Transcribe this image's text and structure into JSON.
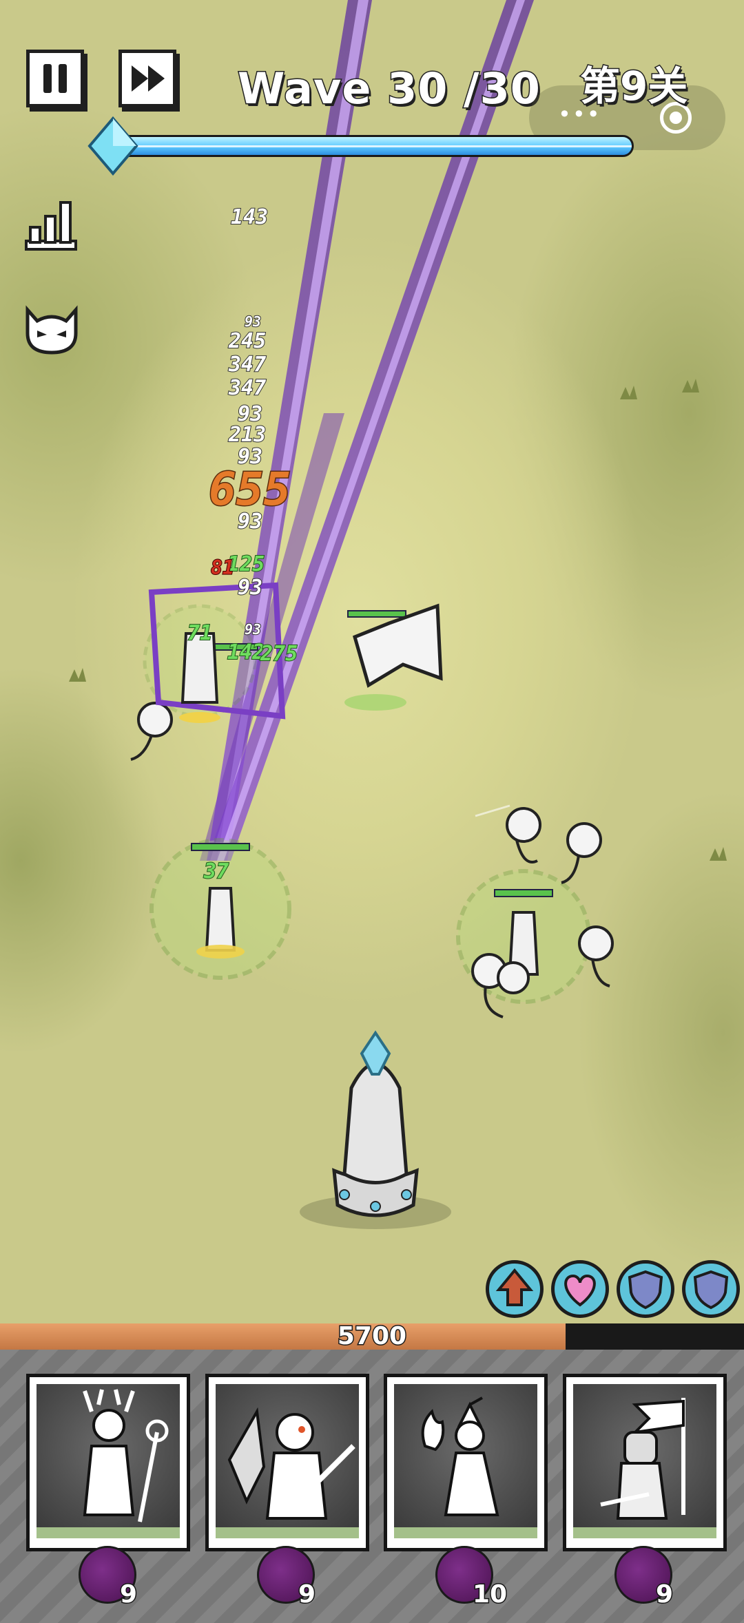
{
  "hud": {
    "wave_label": "Wave 30 /30",
    "level_label": "第9关",
    "pause_icon": "pause-icon",
    "fast_forward_icon": "fast-forward-icon",
    "stats_icon": "bar-chart-icon",
    "enemy_info_icon": "devil-face-icon",
    "more_icon": "more-dots-icon",
    "close_icon": "target-circle-icon",
    "wave_progress": 1.0
  },
  "damage_numbers": [
    "143",
    "245",
    "347",
    "347",
    "93",
    "213",
    "93",
    "655",
    "93",
    "125",
    "93",
    "142",
    "275",
    "71",
    "37",
    "81",
    "93",
    "93",
    "93"
  ],
  "skills": [
    {
      "icon": "attack-up-icon"
    },
    {
      "icon": "heart-icon"
    },
    {
      "icon": "shield-icon"
    },
    {
      "icon": "shield-icon"
    }
  ],
  "base": {
    "hp_label": "5700",
    "hp_fraction": 0.76
  },
  "heroes": [
    {
      "name": "druid-hero-card",
      "icon": "antler-druid-icon",
      "count": "9"
    },
    {
      "name": "bat-demon-hero-card",
      "icon": "winged-demon-icon",
      "count": "9"
    },
    {
      "name": "fire-mage-hero-card",
      "icon": "fire-mage-icon",
      "count": "10"
    },
    {
      "name": "knight-hero-card",
      "icon": "knight-banner-icon",
      "count": "9"
    }
  ],
  "colors": {
    "accent": "#5ec4da",
    "hp": "#c47744",
    "beam": "#7a3fc4",
    "heal": "#6fdc5f",
    "crit": "#e57a2a"
  }
}
